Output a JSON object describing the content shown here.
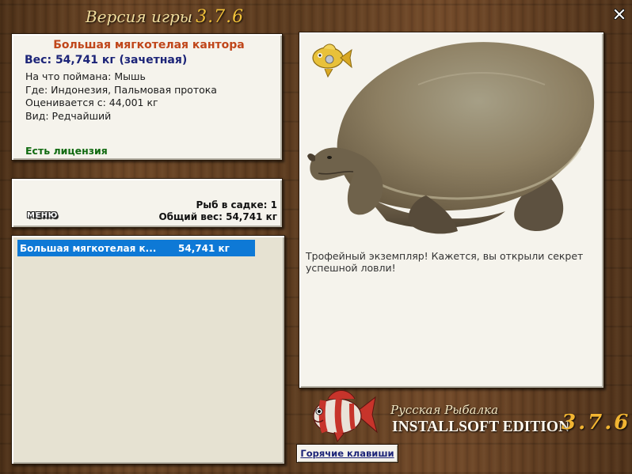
{
  "window": {
    "title": "Версия игры",
    "version": "3.7.6",
    "close_icon": "close-icon"
  },
  "catch": {
    "fish_name": "Большая мягкотелая кантора",
    "weight_line": "Вес: 54,741 кг (зачетная)",
    "caught_on": "На что поймана: Мышь",
    "location": "Где: Индонезия, Пальмовая протока",
    "valuation": "Оценивается с: 44,001 кг",
    "rarity": "Вид: Редчайший",
    "license": "Есть лицензия"
  },
  "stats": {
    "menu_label": "МЕНЮ",
    "fish_in_keepnet": "Рыб в садке: 1",
    "total_weight": "Общий вес: 54,741 кг"
  },
  "keepnet": {
    "items": [
      {
        "name": "Большая мягкотелая к...",
        "weight": "54,741 кг",
        "selected": true
      }
    ]
  },
  "picture": {
    "trophy_icon": "gold-fish-trophy-icon",
    "image": "soft-shell-turtle-image",
    "description": "Трофейный экземпляр! Кажется, вы открыли секрет успешной ловли!"
  },
  "branding": {
    "logo_icon": "red-white-fish-logo",
    "line1": "Русская Рыбалка",
    "line2": "INSTALLSOFT EDITION",
    "version": "3.7.6"
  },
  "footer": {
    "hotkeys_label": "Горячие клавиши"
  },
  "colors": {
    "title_accent": "#f3c23a",
    "fish_name": "#c0461a",
    "weight": "#1c2478",
    "license": "#106a10",
    "selection": "#0e79d6",
    "wood": "#5a3a1e"
  }
}
